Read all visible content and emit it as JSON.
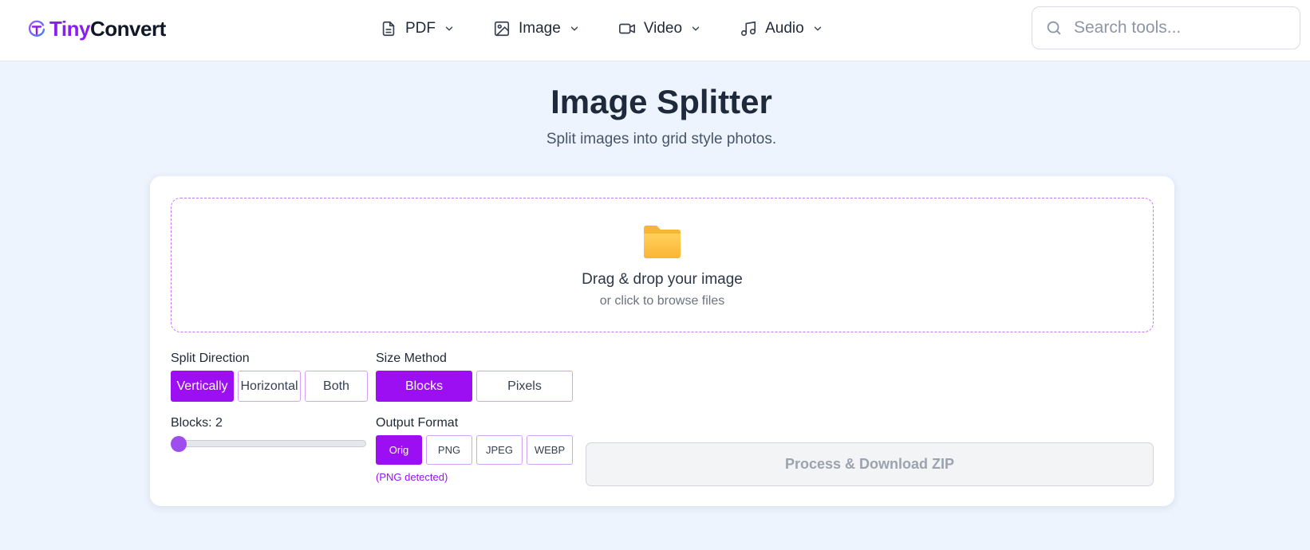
{
  "brand": {
    "name_part1": "Tiny",
    "name_part2": "Convert",
    "accent": "#9b0ff2"
  },
  "nav": [
    {
      "label": "PDF",
      "icon": "file-icon"
    },
    {
      "label": "Image",
      "icon": "image-icon"
    },
    {
      "label": "Video",
      "icon": "video-icon"
    },
    {
      "label": "Audio",
      "icon": "music-icon"
    }
  ],
  "search": {
    "placeholder": "Search tools...",
    "value": ""
  },
  "page": {
    "title": "Image Splitter",
    "subtitle": "Split images into grid style photos."
  },
  "dropzone": {
    "icon": "folder-icon",
    "main": "Drag & drop your image",
    "sub": "or click to browse files"
  },
  "split_direction": {
    "label": "Split Direction",
    "options": [
      "Vertically",
      "Horizontal",
      "Both"
    ],
    "selected": "Vertically"
  },
  "size_method": {
    "label": "Size Method",
    "options": [
      "Blocks",
      "Pixels"
    ],
    "selected": "Blocks"
  },
  "blocks": {
    "label": "Blocks: 2",
    "value": 2,
    "slider_fraction": 0
  },
  "output_format": {
    "label": "Output Format",
    "options": [
      "Orig",
      "PNG",
      "JPEG",
      "WEBP"
    ],
    "selected": "Orig",
    "hint": "(PNG detected)"
  },
  "process_button": {
    "label": "Process & Download ZIP",
    "disabled": true
  }
}
